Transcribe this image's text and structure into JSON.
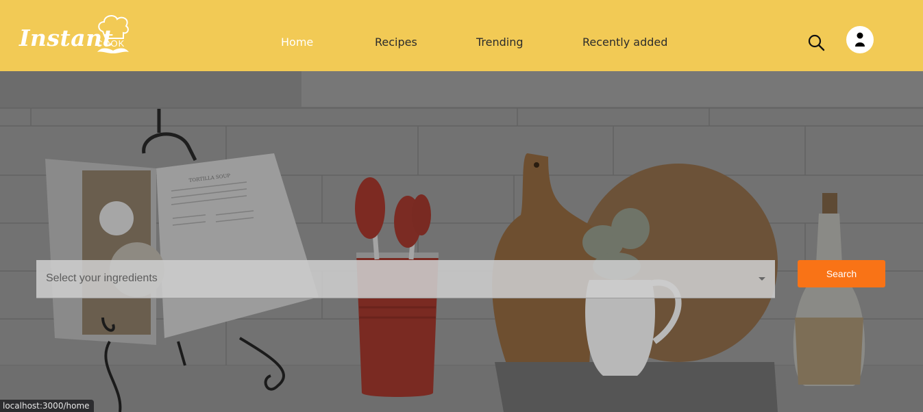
{
  "brand": {
    "logo_script": "Instant",
    "logo_sub": "COOK"
  },
  "nav": {
    "items": [
      {
        "label": "Home",
        "active": true
      },
      {
        "label": "Recipes",
        "active": false
      },
      {
        "label": "Trending",
        "active": false
      },
      {
        "label": "Recently added",
        "active": false
      }
    ]
  },
  "header_icons": {
    "search": "search-icon",
    "profile": "user-avatar-icon"
  },
  "hero": {
    "ingredients_select": {
      "placeholder": "Select your ingredients",
      "value": ""
    },
    "search_button_label": "Search",
    "book_title": "TORTILLA SOUP"
  },
  "status_bar": {
    "url": "localhost:3000/home"
  },
  "colors": {
    "header_bg": "#f2ca55",
    "accent": "#f97316",
    "nav_active": "#ffffff",
    "nav_text": "#2b2b2b"
  }
}
